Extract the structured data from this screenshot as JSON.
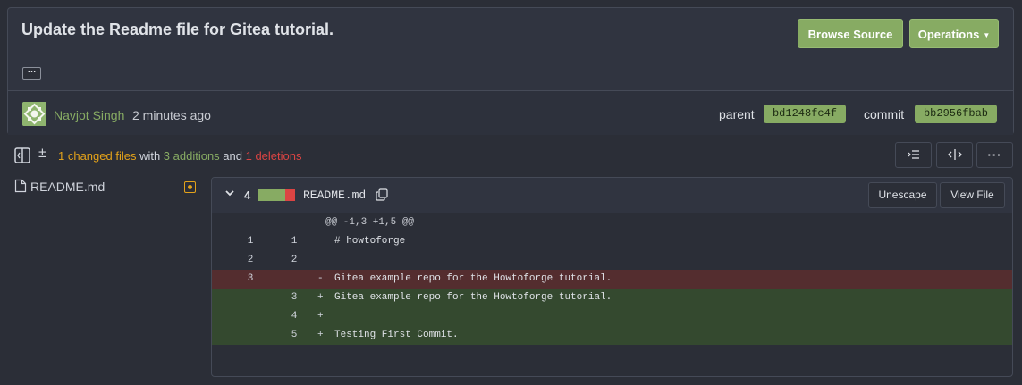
{
  "commit": {
    "title": "Update the Readme file for Gitea tutorial.",
    "ellipsis": "…",
    "browse_source": "Browse Source",
    "operations": "Operations",
    "author": "Navjot Singh",
    "time": "2 minutes ago",
    "parent_label": "parent",
    "parent_sha": "bd1248fc4f",
    "commit_label": "commit",
    "commit_sha": "bb2956fbab"
  },
  "stats": {
    "changed": "1 changed files",
    "with": " with ",
    "additions": "3 additions",
    "and": " and ",
    "deletions": "1 deletions"
  },
  "tree": {
    "file": "README.md"
  },
  "diff": {
    "count": "4",
    "filename": "README.md",
    "unescape": "Unescape",
    "view_file": "View File",
    "hunk": "@@ -1,3 +1,5 @@",
    "lines": [
      {
        "type": "ctx",
        "old": "1",
        "new": "1",
        "sign": "",
        "code": "# howtoforge"
      },
      {
        "type": "ctx",
        "old": "2",
        "new": "2",
        "sign": "",
        "code": ""
      },
      {
        "type": "del",
        "old": "3",
        "new": "",
        "sign": "-",
        "code": "Gitea example repo for the Howtoforge tutorial."
      },
      {
        "type": "add",
        "old": "",
        "new": "3",
        "sign": "+",
        "code": "Gitea example repo for the Howtoforge tutorial."
      },
      {
        "type": "add",
        "old": "",
        "new": "4",
        "sign": "+",
        "code": ""
      },
      {
        "type": "add",
        "old": "",
        "new": "5",
        "sign": "+",
        "code": "Testing First Commit."
      }
    ]
  },
  "colors": {
    "accent_green": "#87ab63",
    "orange": "#e3a21a",
    "red": "#db4443",
    "del_bg": "#542d2f",
    "add_bg": "#34492f"
  },
  "icons": [
    "split-view-icon",
    "plus-minus-icon",
    "file-icon",
    "modified-icon",
    "chevron-down-icon",
    "copy-icon",
    "toc-icon",
    "expand-icon",
    "more-icon"
  ]
}
